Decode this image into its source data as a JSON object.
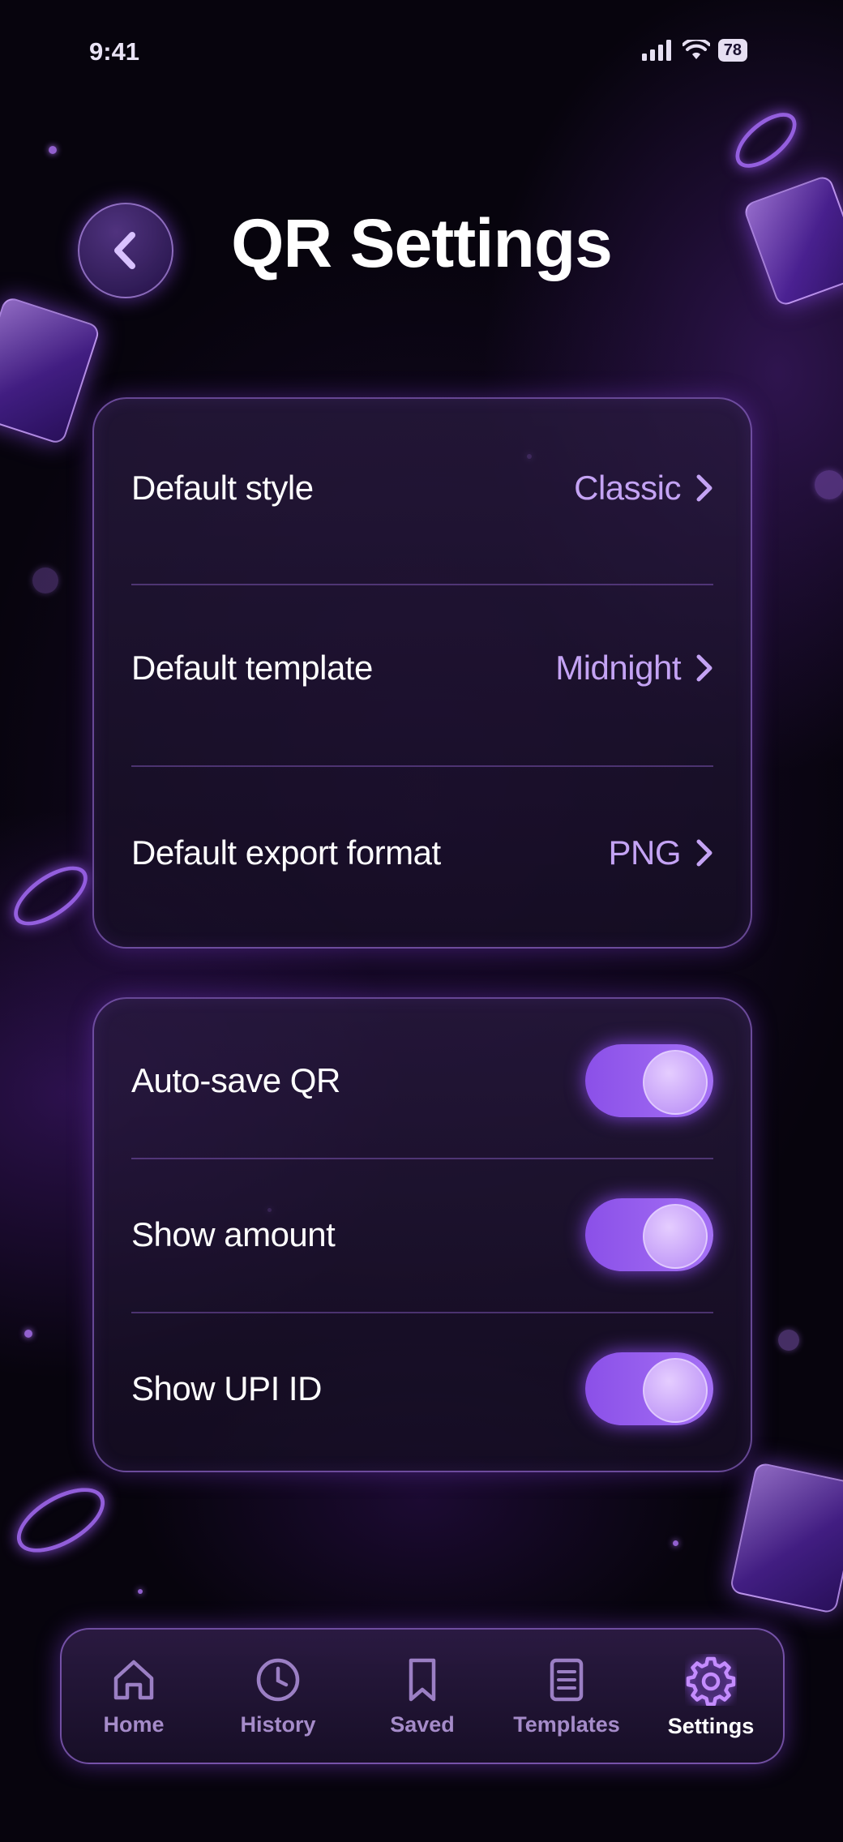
{
  "status_bar": {
    "time": "9:41",
    "battery": "78"
  },
  "header": {
    "title": "QR Settings"
  },
  "defaults_card": {
    "rows": [
      {
        "label": "Default style",
        "value": "Classic"
      },
      {
        "label": "Default template",
        "value": "Midnight"
      },
      {
        "label": "Default export format",
        "value": "PNG"
      }
    ]
  },
  "toggles_card": {
    "rows": [
      {
        "label": "Auto-save QR",
        "on": true
      },
      {
        "label": "Show amount",
        "on": true
      },
      {
        "label": "Show UPI ID",
        "on": true
      }
    ]
  },
  "tab_bar": {
    "tabs": [
      {
        "label": "Home",
        "icon": "home-icon"
      },
      {
        "label": "History",
        "icon": "clock-icon"
      },
      {
        "label": "Saved",
        "icon": "bookmark-icon"
      },
      {
        "label": "Templates",
        "icon": "document-icon"
      },
      {
        "label": "Settings",
        "icon": "gear-icon",
        "active": true
      }
    ]
  },
  "colors": {
    "accent": "#a470f5",
    "value_text": "#c4a3f4",
    "background": "#07040d"
  }
}
